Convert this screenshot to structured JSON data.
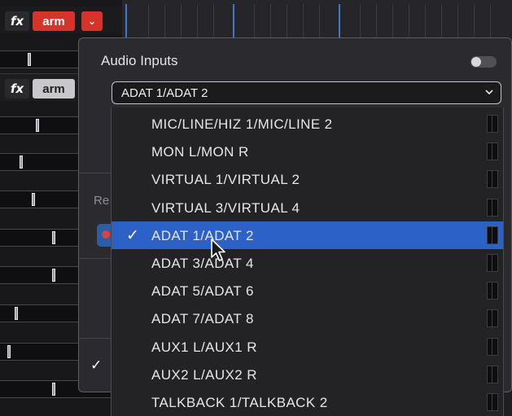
{
  "tracks": [
    {
      "fx_label": "fx",
      "arm_label": "arm",
      "armed": true
    },
    {
      "fx_label": "fx",
      "arm_label": "arm",
      "armed": false
    }
  ],
  "panel": {
    "title": "Audio Inputs",
    "selected_value": "ADAT 1/ADAT 2",
    "partial_label": "Re",
    "left_check": "✓"
  },
  "dropdown": {
    "selected_index": 4,
    "check_mark": "✓",
    "options": [
      "MIC/LINE/HIZ 1/MIC/LINE 2",
      "MON L/MON R",
      "VIRTUAL 1/VIRTUAL 2",
      "VIRTUAL 3/VIRTUAL 4",
      "ADAT 1/ADAT 2",
      "ADAT 3/ADAT 4",
      "ADAT 5/ADAT 6",
      "ADAT 7/ADAT 8",
      "AUX1 L/AUX1 R",
      "AUX2 L/AUX2 R",
      "TALKBACK 1/TALKBACK 2"
    ]
  },
  "colors": {
    "accent_red": "#d6342a",
    "selection_blue": "#2c62c8",
    "record_swatch": "#2b5ea8"
  },
  "icons": {
    "track_options": "chevron-down-icon",
    "select_arrow": "chevron-down-icon",
    "pointer": "mouse-cursor-icon"
  }
}
